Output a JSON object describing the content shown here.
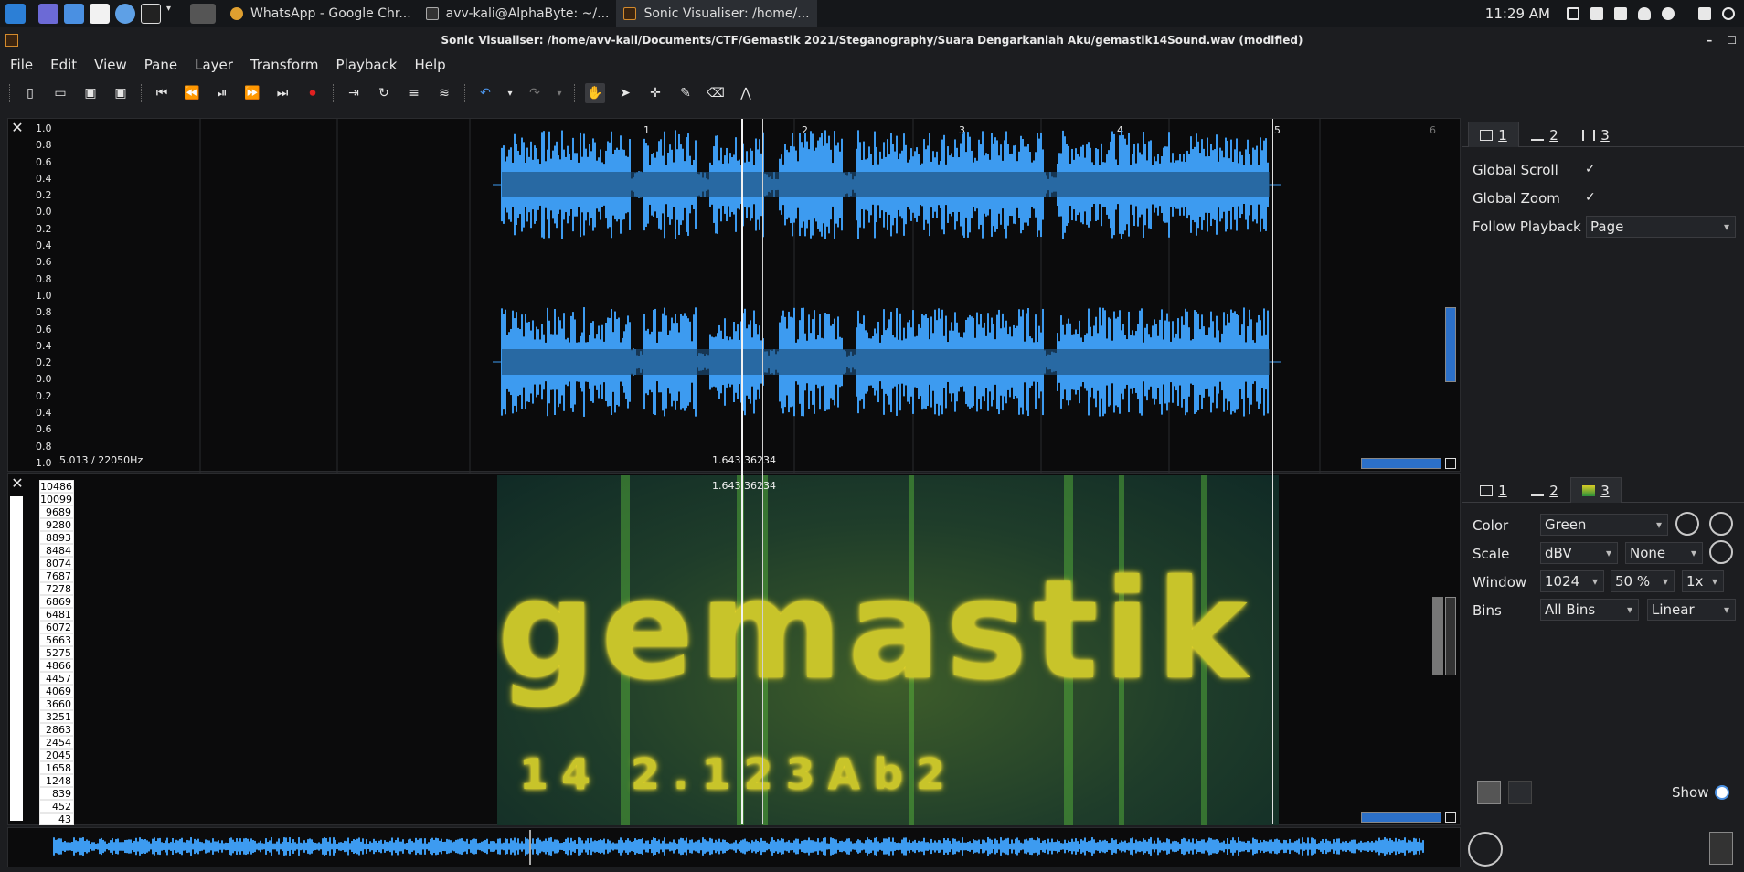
{
  "taskbar": {
    "tasks": [
      {
        "label": "WhatsApp - Google Chr..."
      },
      {
        "label": "avv-kali@AlphaByte: ~/..."
      },
      {
        "label": "Sonic Visualiser: /home/..."
      }
    ],
    "clock": "11:29 AM"
  },
  "window": {
    "title": "Sonic Visualiser: /home/avv-kali/Documents/CTF/Gemastik 2021/Steganography/Suara Dengarkanlah Aku/gemastik14Sound.wav (modified)"
  },
  "menu": [
    "File",
    "Edit",
    "View",
    "Pane",
    "Layer",
    "Transform",
    "Playback",
    "Help"
  ],
  "waveform": {
    "scale_labels": [
      "1.0",
      "0.8",
      "0.6",
      "0.4",
      "0.2",
      "0.0",
      "0.2",
      "0.4",
      "0.6",
      "0.8",
      "1.0",
      "0.8",
      "0.6",
      "0.4",
      "0.2",
      "0.0",
      "0.2",
      "0.4",
      "0.6",
      "0.8",
      "1.0"
    ],
    "ruler_marks": [
      "1",
      "2",
      "3",
      "4",
      "5",
      "6"
    ],
    "info_left": "5.013 / 22050Hz",
    "cursor_readout": "1.643   36234"
  },
  "spectrogram": {
    "freq_labels": [
      "10486",
      "10099",
      "9689",
      "9280",
      "8893",
      "8484",
      "8074",
      "7687",
      "7278",
      "6869",
      "6481",
      "6072",
      "5663",
      "5275",
      "4866",
      "4457",
      "4069",
      "3660",
      "3251",
      "2863",
      "2454",
      "2045",
      "1658",
      "1248",
      "839",
      "452",
      "43"
    ],
    "cursor_readout": "1.643   36234",
    "hidden_text": "gemastik",
    "hidden_text_2": "14   2.123Ab2"
  },
  "props_top": {
    "tabs": [
      "1",
      "2",
      "3"
    ],
    "global_scroll_label": "Global Scroll",
    "global_scroll_check": "✓",
    "global_zoom_label": "Global Zoom",
    "global_zoom_check": "✓",
    "follow_playback_label": "Follow Playback",
    "follow_playback_value": "Page"
  },
  "props_bot": {
    "tabs": [
      "1",
      "2",
      "3"
    ],
    "color_label": "Color",
    "color_value": "Green",
    "scale_label": "Scale",
    "scale_value": "dBV",
    "scale_value2": "None",
    "window_label": "Window",
    "window_value": "1024",
    "window_overlap": "50 %",
    "window_oversample": "1x",
    "bins_label": "Bins",
    "bins_value": "All Bins",
    "bins_scale": "Linear",
    "show_label": "Show"
  },
  "colors": {
    "wave_blue": "#3d9bf0",
    "wave_dark": "#1d4f7a",
    "spectro_yellow": "#d8cc26"
  }
}
